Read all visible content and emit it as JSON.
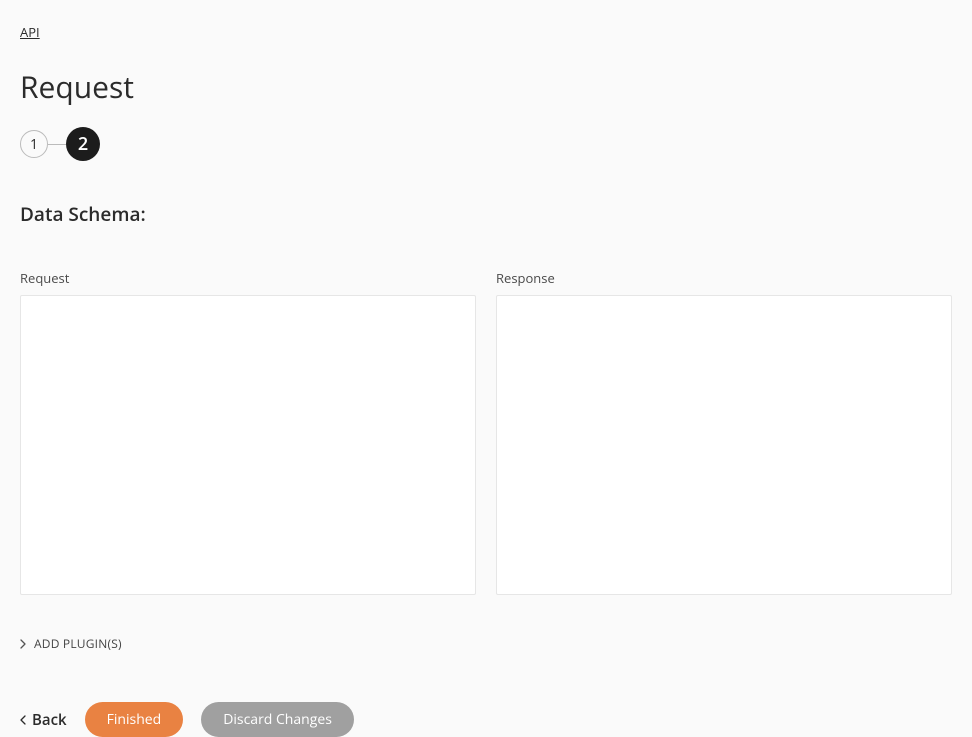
{
  "breadcrumb": {
    "label": "API"
  },
  "page": {
    "title": "Request"
  },
  "stepper": {
    "steps": [
      "1",
      "2"
    ],
    "active_index": 1
  },
  "section": {
    "title": "Data Schema:"
  },
  "schema": {
    "request": {
      "label": "Request",
      "value": ""
    },
    "response": {
      "label": "Response",
      "value": ""
    }
  },
  "plugins": {
    "add_label": "ADD PLUGIN(S)"
  },
  "footer": {
    "back_label": "Back",
    "finished_label": "Finished",
    "discard_label": "Discard Changes"
  }
}
